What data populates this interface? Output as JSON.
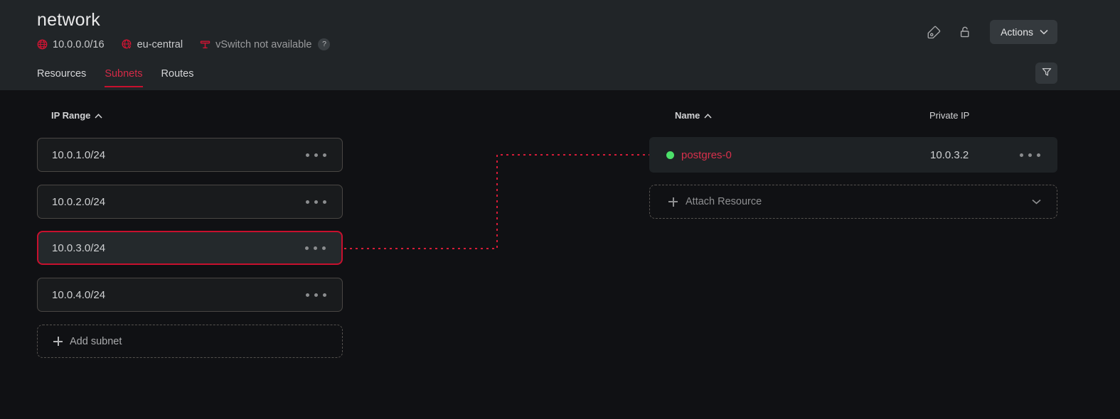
{
  "header": {
    "title": "network",
    "meta": [
      {
        "icon": "globe-icon",
        "text": "10.0.0.0/16",
        "muted": false
      },
      {
        "icon": "region-icon",
        "text": "eu-central",
        "muted": false
      },
      {
        "icon": "vswitch-icon",
        "text": "vSwitch not available",
        "muted": true
      }
    ],
    "help_badge": "?",
    "tag_icon": "tag-icon",
    "lock_icon": "unlock-icon",
    "actions_label": "Actions",
    "actions_chevron": "chevron-down-icon",
    "filter_icon": "filter-icon"
  },
  "tabs": [
    {
      "label": "Resources",
      "active": false
    },
    {
      "label": "Subnets",
      "active": true
    },
    {
      "label": "Routes",
      "active": false
    }
  ],
  "subnets_panel": {
    "column_header": "IP Range",
    "sort_icon": "caret-up-icon",
    "items": [
      {
        "ip": "10.0.1.0/24",
        "selected": false
      },
      {
        "ip": "10.0.2.0/24",
        "selected": false
      },
      {
        "ip": "10.0.3.0/24",
        "selected": true
      },
      {
        "ip": "10.0.4.0/24",
        "selected": false
      }
    ],
    "add_label": "Add subnet",
    "add_icon": "plus-icon",
    "row_menu_icon": "kebab-menu-icon"
  },
  "resources_panel": {
    "columns": [
      "Name",
      "Private IP"
    ],
    "sort_icon": "caret-up-icon",
    "rows": [
      {
        "status": "running",
        "name": "postgres-0",
        "private_ip": "10.0.3.2"
      }
    ],
    "attach_label": "Attach Resource",
    "attach_icon": "plus-icon",
    "attach_chevron": "chevron-down-icon",
    "row_menu_icon": "kebab-menu-icon"
  },
  "colors": {
    "accent": "#c8102e",
    "accent_text": "#d8304c",
    "status_running": "#4ce06a",
    "page_bg": "#101114",
    "header_bg": "#212528",
    "card_bg": "#191b1d",
    "selected_card_bg": "#24292c",
    "row_bg": "#1e2225",
    "connector": "#d61c38"
  }
}
